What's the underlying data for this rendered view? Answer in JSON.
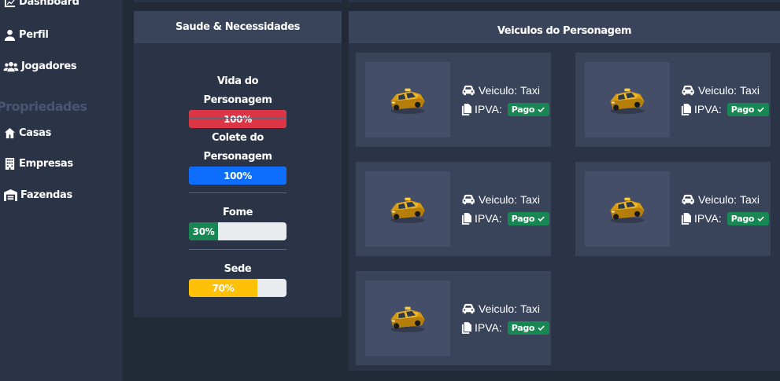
{
  "sidebar": {
    "items": [
      {
        "label": "Dashboard",
        "icon": "chart-line-icon"
      },
      {
        "label": "Perfil",
        "icon": "user-icon"
      },
      {
        "label": "Jogadores",
        "icon": "users-icon"
      }
    ],
    "section": "Propriedades",
    "property_items": [
      {
        "label": "Casas",
        "icon": "house-icon"
      },
      {
        "label": "Empresas",
        "icon": "building-icon"
      },
      {
        "label": "Fazendas",
        "icon": "warehouse-icon"
      }
    ]
  },
  "health": {
    "title": "Saude & Necessidades",
    "stats": [
      {
        "label": "Vida do Personagem",
        "value": "100%",
        "percent": 100,
        "color": "#dc3545"
      },
      {
        "label": "Colete do Personagem",
        "value": "100%",
        "percent": 100,
        "color": "#0d6efd"
      },
      {
        "label": "Fome",
        "value": "30%",
        "percent": 30,
        "color": "#198754"
      },
      {
        "label": "Sede",
        "value": "70%",
        "percent": 70,
        "color": "#ffc107"
      }
    ]
  },
  "vehicles": {
    "title": "Veiculos do Personagem",
    "vehicle_label": "Veiculo:",
    "tax_label": "IPVA:",
    "items": [
      {
        "name": "Taxi",
        "status": "Pago"
      },
      {
        "name": "Taxi",
        "status": "Pago"
      },
      {
        "name": "Taxi",
        "status": "Pago"
      },
      {
        "name": "Taxi",
        "status": "Pago"
      },
      {
        "name": "Taxi",
        "status": "Pago"
      }
    ]
  },
  "colors": {
    "background": "#222a38",
    "panel": "#2b3446",
    "panel_header": "#39435a",
    "badge": "#198754"
  }
}
